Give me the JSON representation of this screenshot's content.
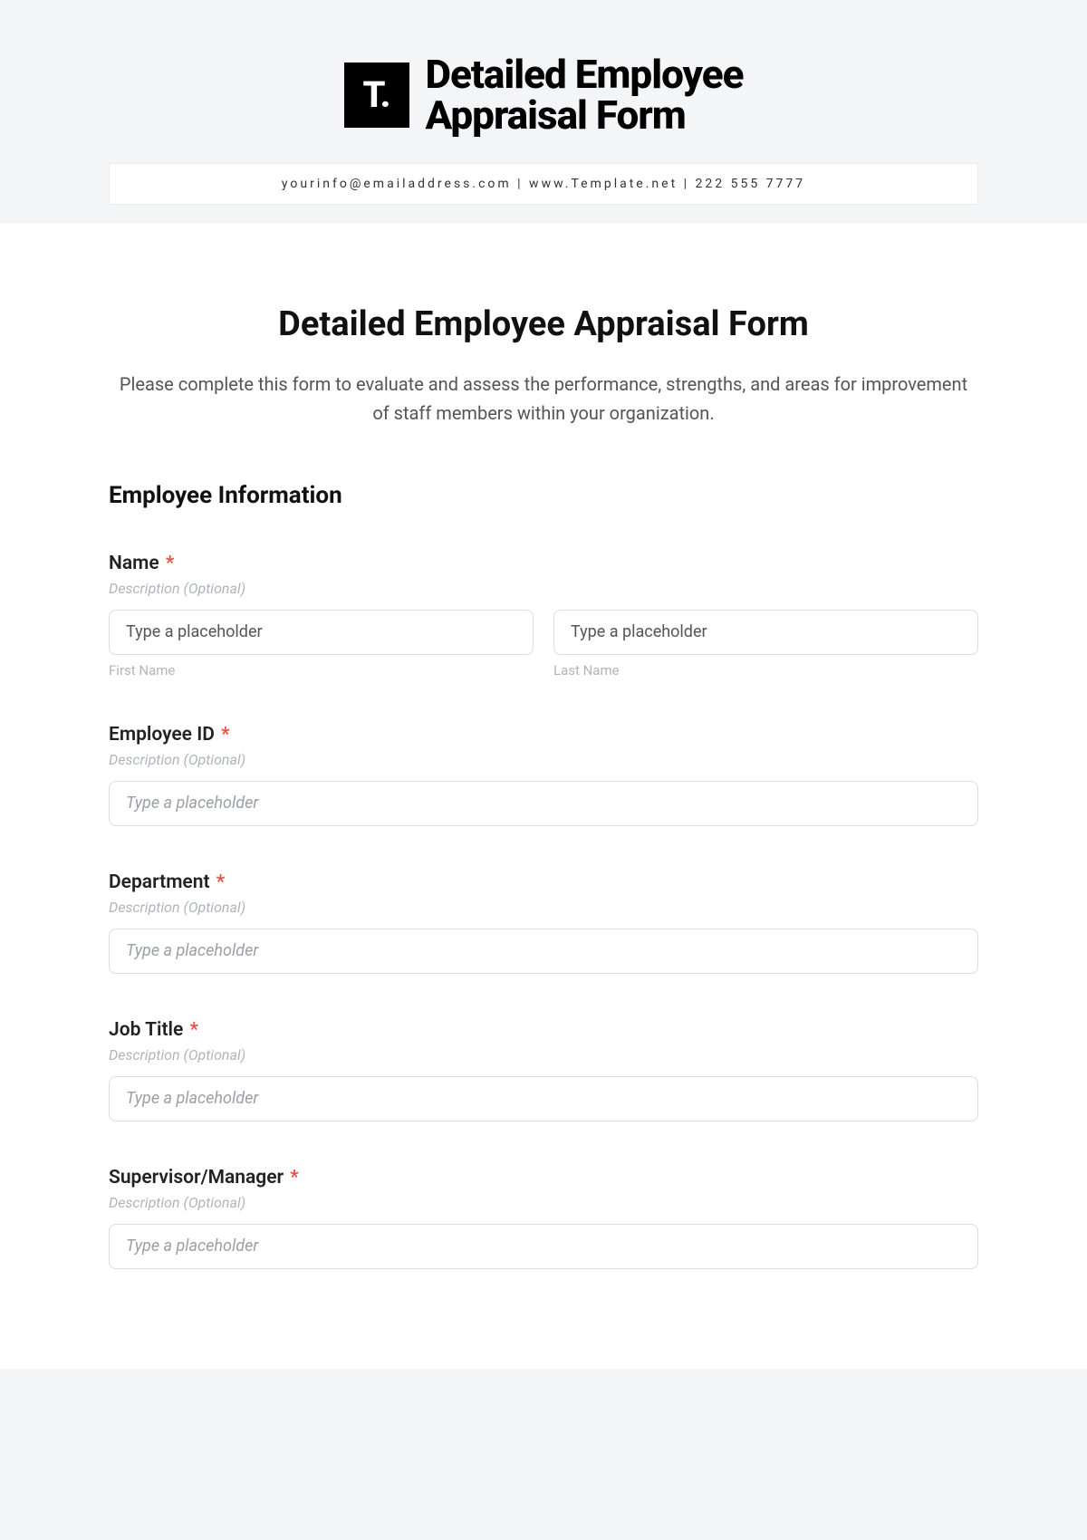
{
  "header": {
    "logo_letter": "T.",
    "title_line1": "Detailed Employee",
    "title_line2": "Appraisal Form",
    "contact_line": "yourinfo@emailaddress.com | www.Template.net | 222 555 7777"
  },
  "form": {
    "title": "Detailed Employee Appraisal Form",
    "intro": "Please complete this form to evaluate and assess the performance, strengths, and areas for improvement of staff members within your organization.",
    "section_heading": "Employee Information",
    "fields": {
      "name": {
        "label": "Name",
        "required_mark": "*",
        "desc": "Description (Optional)",
        "first_placeholder": "Type a placeholder",
        "first_sublabel": "First Name",
        "last_placeholder": "Type a placeholder",
        "last_sublabel": "Last Name"
      },
      "employee_id": {
        "label": "Employee ID",
        "required_mark": "*",
        "desc": "Description (Optional)",
        "placeholder": "Type a placeholder"
      },
      "department": {
        "label": "Department",
        "required_mark": "*",
        "desc": "Description (Optional)",
        "placeholder": "Type a placeholder"
      },
      "job_title": {
        "label": "Job Title",
        "required_mark": "*",
        "desc": "Description (Optional)",
        "placeholder": "Type a placeholder"
      },
      "supervisor": {
        "label": "Supervisor/Manager",
        "required_mark": "*",
        "desc": "Description (Optional)",
        "placeholder": "Type a placeholder"
      }
    }
  }
}
